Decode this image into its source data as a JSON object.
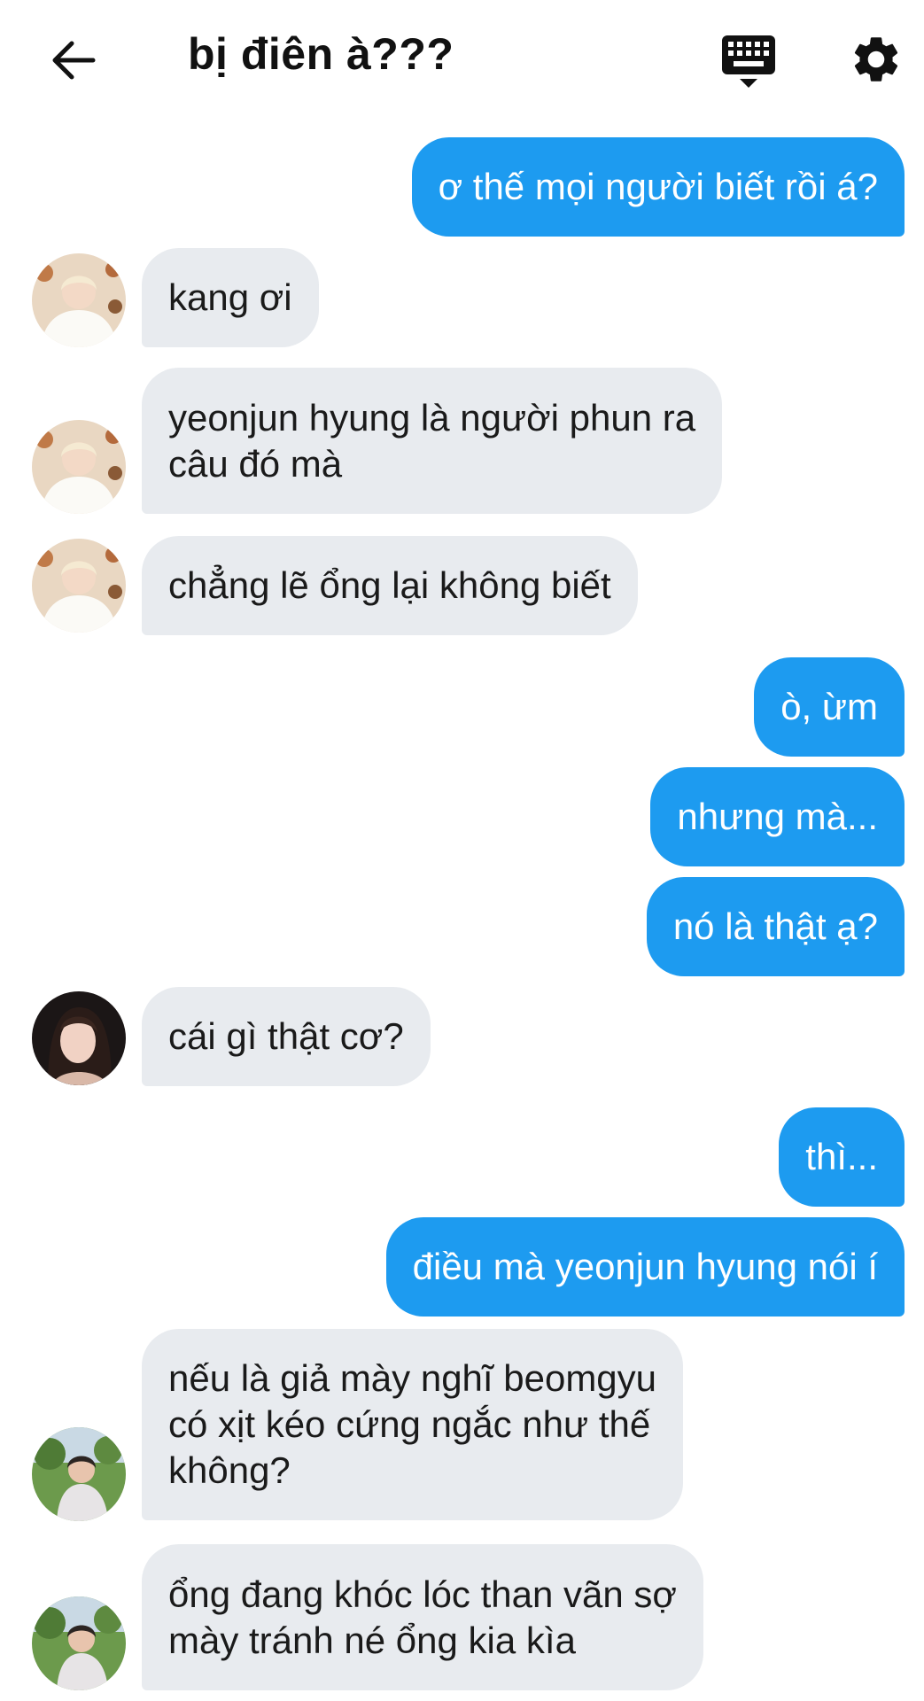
{
  "header": {
    "title": "bị điên à???",
    "back_icon": "arrow-left-icon",
    "keyboard_icon": "keyboard-icon",
    "settings_icon": "gear-icon"
  },
  "colors": {
    "outgoing_bubble": "#1d9bf0",
    "incoming_bubble": "#e8ebef",
    "text_dark": "#1a1a1a"
  },
  "messages": [
    {
      "side": "out",
      "text": "ơ thế mọi người biết rồi á?"
    },
    {
      "side": "in",
      "avatar": "avatar-white-sweater",
      "text": "kang ơi"
    },
    {
      "side": "in",
      "avatar": "avatar-white-sweater",
      "text": "yeonjun hyung là người phun ra\ncâu đó mà"
    },
    {
      "side": "in",
      "avatar": "avatar-white-sweater",
      "text": "chẳng lẽ ổng lại không biết"
    },
    {
      "side": "out",
      "text": "ò, ừm"
    },
    {
      "side": "out",
      "text": "nhưng mà..."
    },
    {
      "side": "out",
      "text": "nó là thật ạ?"
    },
    {
      "side": "in",
      "avatar": "avatar-dark-hair",
      "text": "cái gì thật cơ?"
    },
    {
      "side": "out",
      "text": "thì..."
    },
    {
      "side": "out",
      "text": "điều mà yeonjun hyung nói í"
    },
    {
      "side": "in",
      "avatar": "avatar-outdoor",
      "text": "nếu là giả mày nghĩ beomgyu\ncó xịt kéo cứng ngắc như thế\nkhông?"
    },
    {
      "side": "in",
      "avatar": "avatar-outdoor",
      "text": "ổng đang khóc lóc than vãn sợ\nmày tránh né ổng kia kìa"
    }
  ]
}
